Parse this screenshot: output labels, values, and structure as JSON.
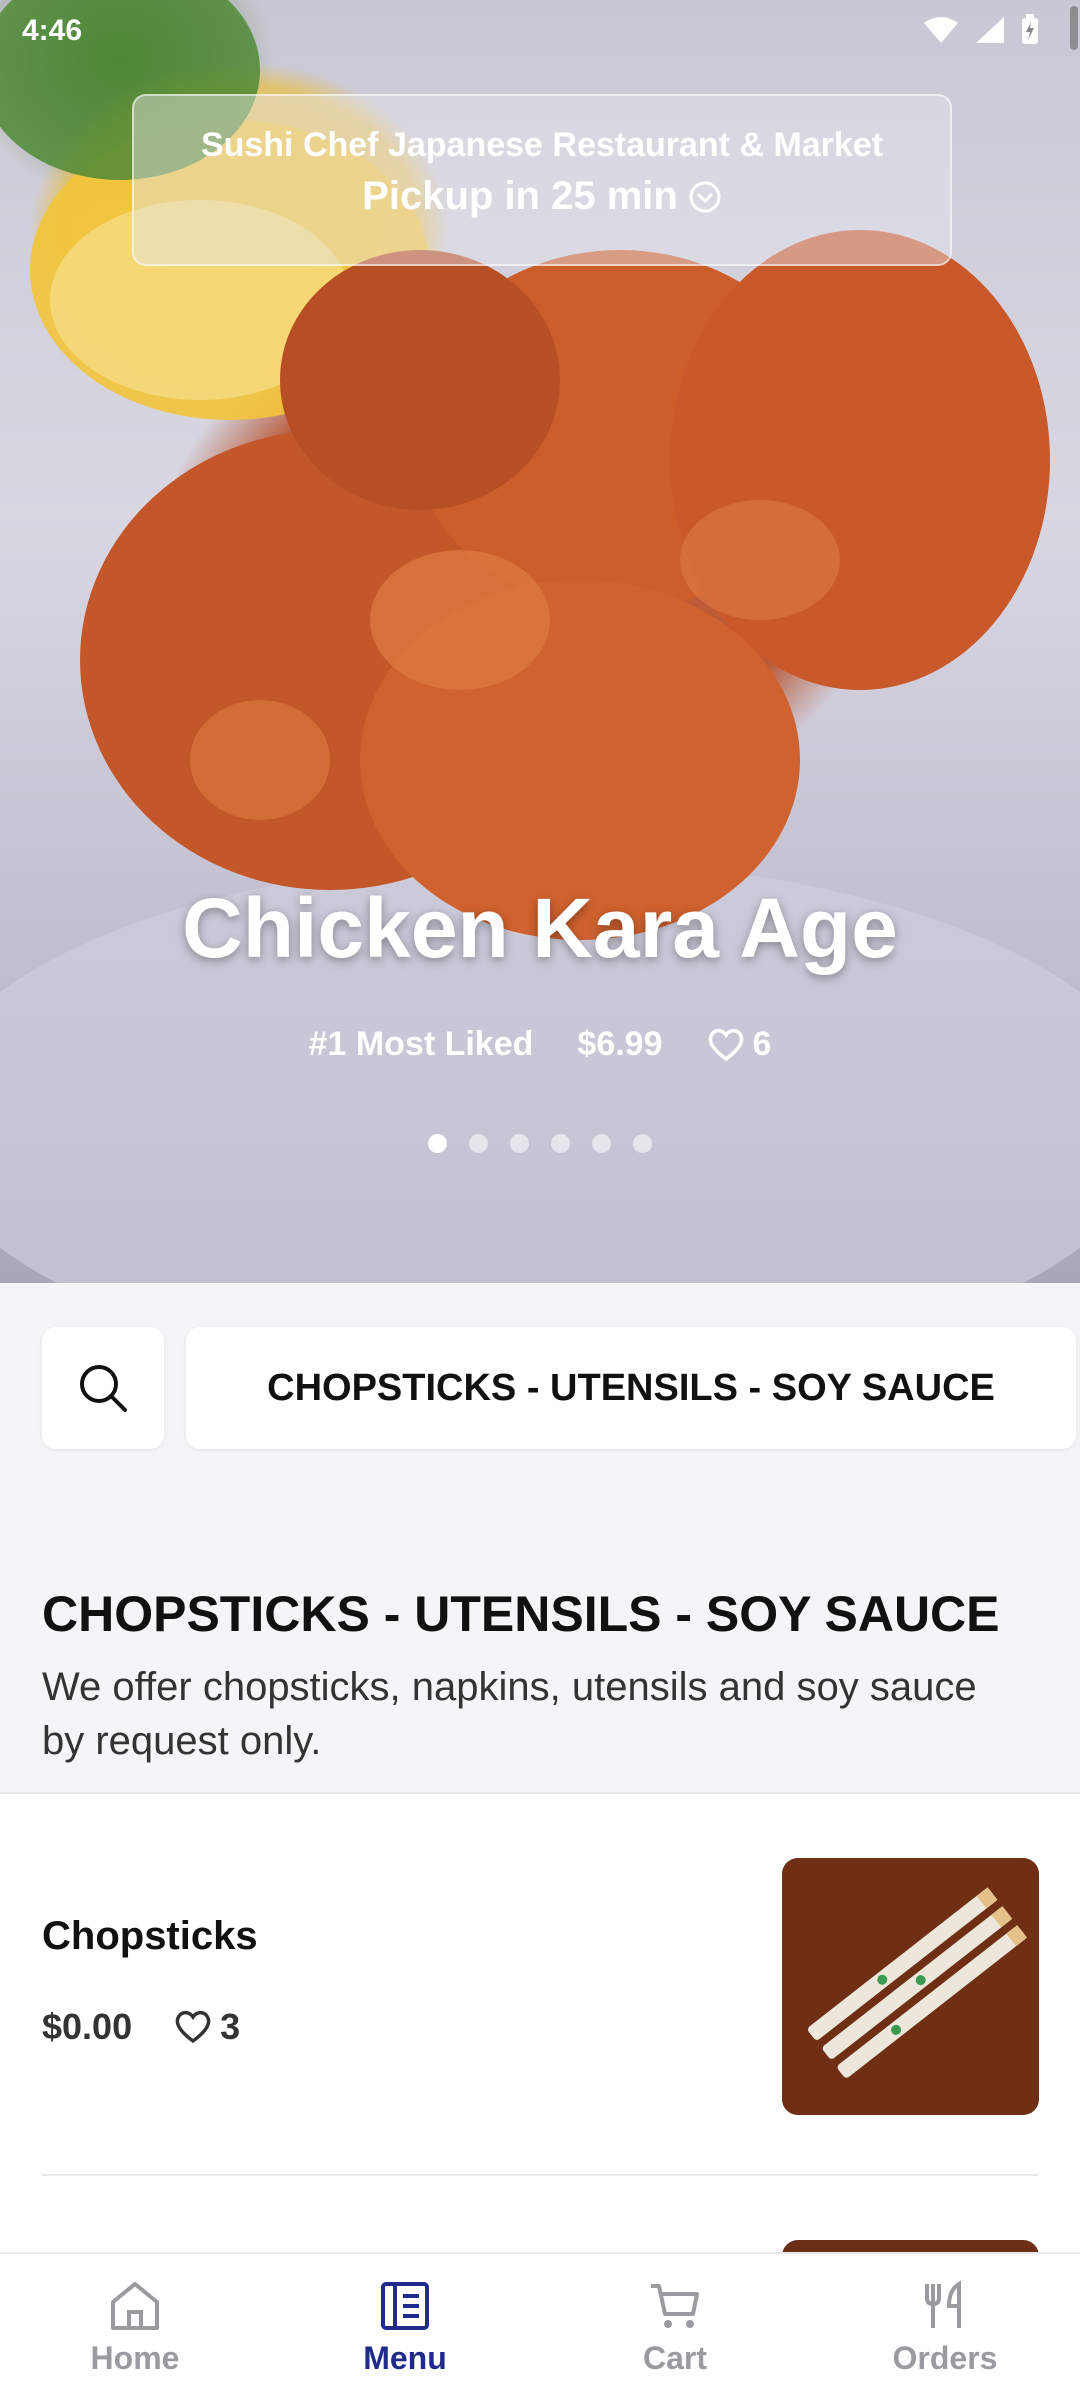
{
  "status_bar": {
    "time": "4:46"
  },
  "store": {
    "name": "Sushi Chef Japanese Restaurant & Market",
    "pickup": "Pickup in 25 min"
  },
  "featured": {
    "title": "Chicken Kara Age",
    "badge": "#1 Most Liked",
    "price": "$6.99",
    "likes": "6",
    "carousel_total": 6,
    "carousel_active": 1
  },
  "category_chip": {
    "label": "CHOPSTICKS - UTENSILS - SOY SAUCE"
  },
  "section": {
    "title": "CHOPSTICKS - UTENSILS - SOY SAUCE",
    "description": "We offer chopsticks, napkins, utensils and soy sauce by request only."
  },
  "items": [
    {
      "name": "Chopsticks",
      "price": "$0.00",
      "likes": "3"
    }
  ],
  "nav": [
    {
      "label": "Home",
      "icon": "home-icon",
      "active": false
    },
    {
      "label": "Menu",
      "icon": "menu-icon",
      "active": true
    },
    {
      "label": "Cart",
      "icon": "cart-icon",
      "active": false
    },
    {
      "label": "Orders",
      "icon": "utensils-icon",
      "active": false
    }
  ],
  "colors": {
    "accent": "#1f2a8c",
    "inactive": "#9a9a9f"
  }
}
